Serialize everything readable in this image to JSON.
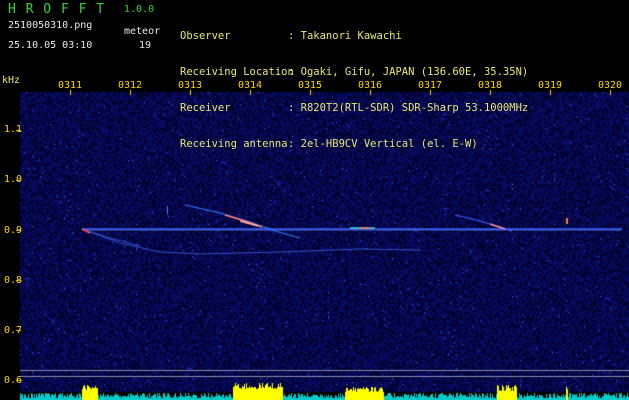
{
  "app": {
    "name": "H R O F F T",
    "version": "1.0.0",
    "filename": "2510050310.png",
    "datetime": "25.10.05 03:10",
    "meteor_label": "meteor",
    "meteor_count": "19"
  },
  "info": {
    "labels": [
      "Observer",
      "Receiving Location",
      "Receiver",
      "Receiving antenna"
    ],
    "values": [
      ": Takanori Kawachi",
      ": Ogaki, Gifu, JAPAN (136.60E, 35.35N)",
      ": R820T2(RTL-SDR) SDR-Sharp 53.1000MHz",
      ": 2el-HB9CV Vertical (el. E-W)"
    ]
  },
  "axis": {
    "unit": "kHz",
    "time_ticks": [
      "0311",
      "0312",
      "0313",
      "0314",
      "0315",
      "0316",
      "0317",
      "0318",
      "0319",
      "0320"
    ],
    "freq_ticks": [
      "1.1",
      "1.0",
      "0.9",
      "0.8",
      "0.7",
      "0.6"
    ]
  },
  "colors": {
    "text_green": "#35d435",
    "tick_yellow": "#ffd700",
    "background_noise": "#0a0a50",
    "carrier_line": "#3050ff",
    "activity_bar": "#ffff00",
    "baseline_fill": "#00d4d4"
  }
}
